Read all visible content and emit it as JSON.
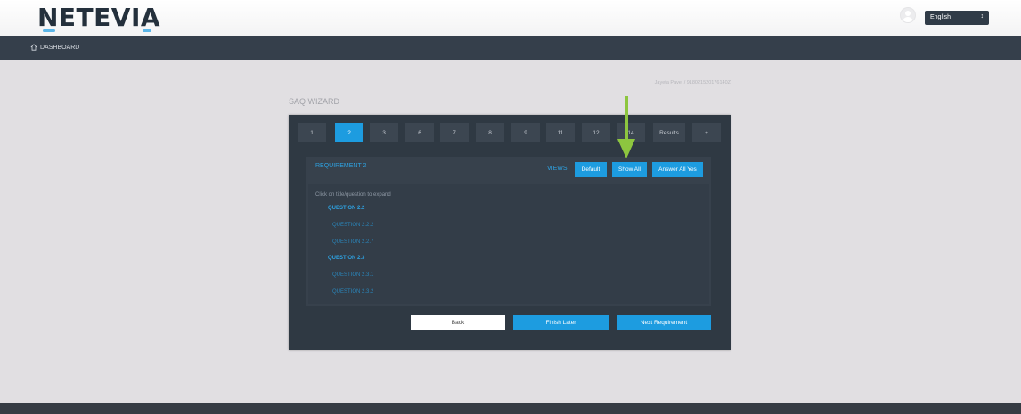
{
  "header": {
    "logo_text": "NETEVIA",
    "language": {
      "selected": "English"
    }
  },
  "nav": {
    "dashboard_label": "DASHBOARD"
  },
  "breadcrumb_user": "Jayeta Pavel / 918021520176140Z",
  "wizard": {
    "title": "SAQ WIZARD",
    "tabs": [
      {
        "label": "1",
        "active": false
      },
      {
        "label": "2",
        "active": true
      },
      {
        "label": "3",
        "active": false
      },
      {
        "label": "6",
        "active": false
      },
      {
        "label": "7",
        "active": false
      },
      {
        "label": "8",
        "active": false
      },
      {
        "label": "9",
        "active": false
      },
      {
        "label": "11",
        "active": false
      },
      {
        "label": "12",
        "active": false
      },
      {
        "label": "14",
        "active": false
      },
      {
        "label": "Results",
        "active": false
      },
      {
        "label": "+",
        "active": false
      }
    ],
    "requirement_title": "REQUIREMENT 2",
    "views_label": "VIEWS:",
    "view_buttons": [
      "Default",
      "Show All",
      "Answer All Yes"
    ],
    "hint": "Click on title/question to expand",
    "questions": [
      {
        "label": "QUESTION 2.2",
        "level": "main"
      },
      {
        "label": "QUESTION 2.2.2",
        "level": "sub"
      },
      {
        "label": "QUESTION 2.2.7",
        "level": "sub"
      },
      {
        "label": "QUESTION 2.3",
        "level": "main"
      },
      {
        "label": "QUESTION 2.3.1",
        "level": "sub"
      },
      {
        "label": "QUESTION 2.3.2",
        "level": "sub"
      }
    ],
    "footer_buttons": {
      "back": "Back",
      "finish_later": "Finish Later",
      "next": "Next Requirement"
    }
  },
  "colors": {
    "accent": "#1d9ce0",
    "panel": "#2f3943",
    "navbar": "#353f4b",
    "arrow": "#8dc63f"
  }
}
